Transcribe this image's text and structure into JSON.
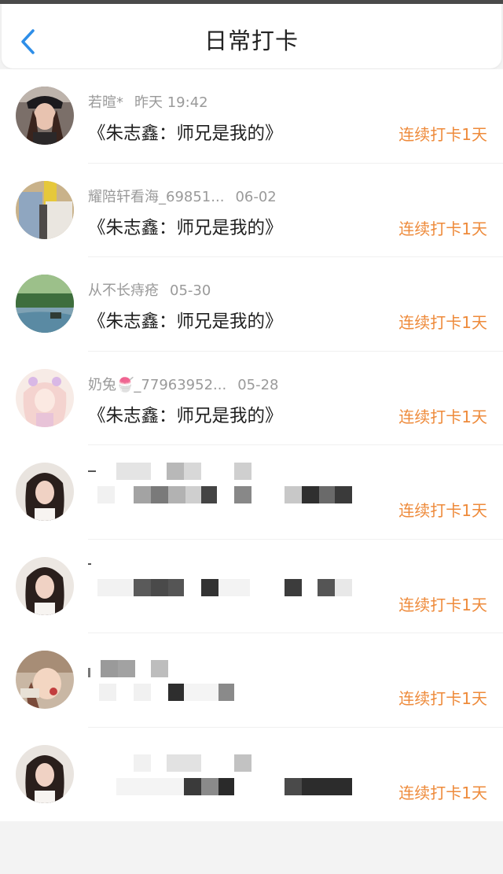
{
  "header": {
    "title": "日常打卡",
    "back_icon": "chevron-left-icon"
  },
  "colors": {
    "accent": "#ee8a3a",
    "back": "#2e8ee8",
    "meta": "#9a9a9a"
  },
  "entries": [
    {
      "name": "若暄*",
      "date": "昨天 19:42",
      "book": "《朱志鑫：师兄是我的》",
      "checkin": "连续打卡1天"
    },
    {
      "name": "耀陪轩看海_69851...",
      "date": "06-02",
      "book": "《朱志鑫：师兄是我的》",
      "checkin": "连续打卡1天"
    },
    {
      "name": "从不长痔疮",
      "date": "05-30",
      "book": "《朱志鑫：师兄是我的》",
      "checkin": "连续打卡1天"
    },
    {
      "name": "奶兔🍧_77963952...",
      "date": "05-28",
      "book": "《朱志鑫：师兄是我的》",
      "checkin": "连续打卡1天"
    },
    {
      "checkin": "连续打卡1天"
    },
    {
      "checkin": "连续打卡1天"
    },
    {
      "checkin": "连续打卡1天"
    },
    {
      "checkin": "连续打卡1天"
    }
  ]
}
